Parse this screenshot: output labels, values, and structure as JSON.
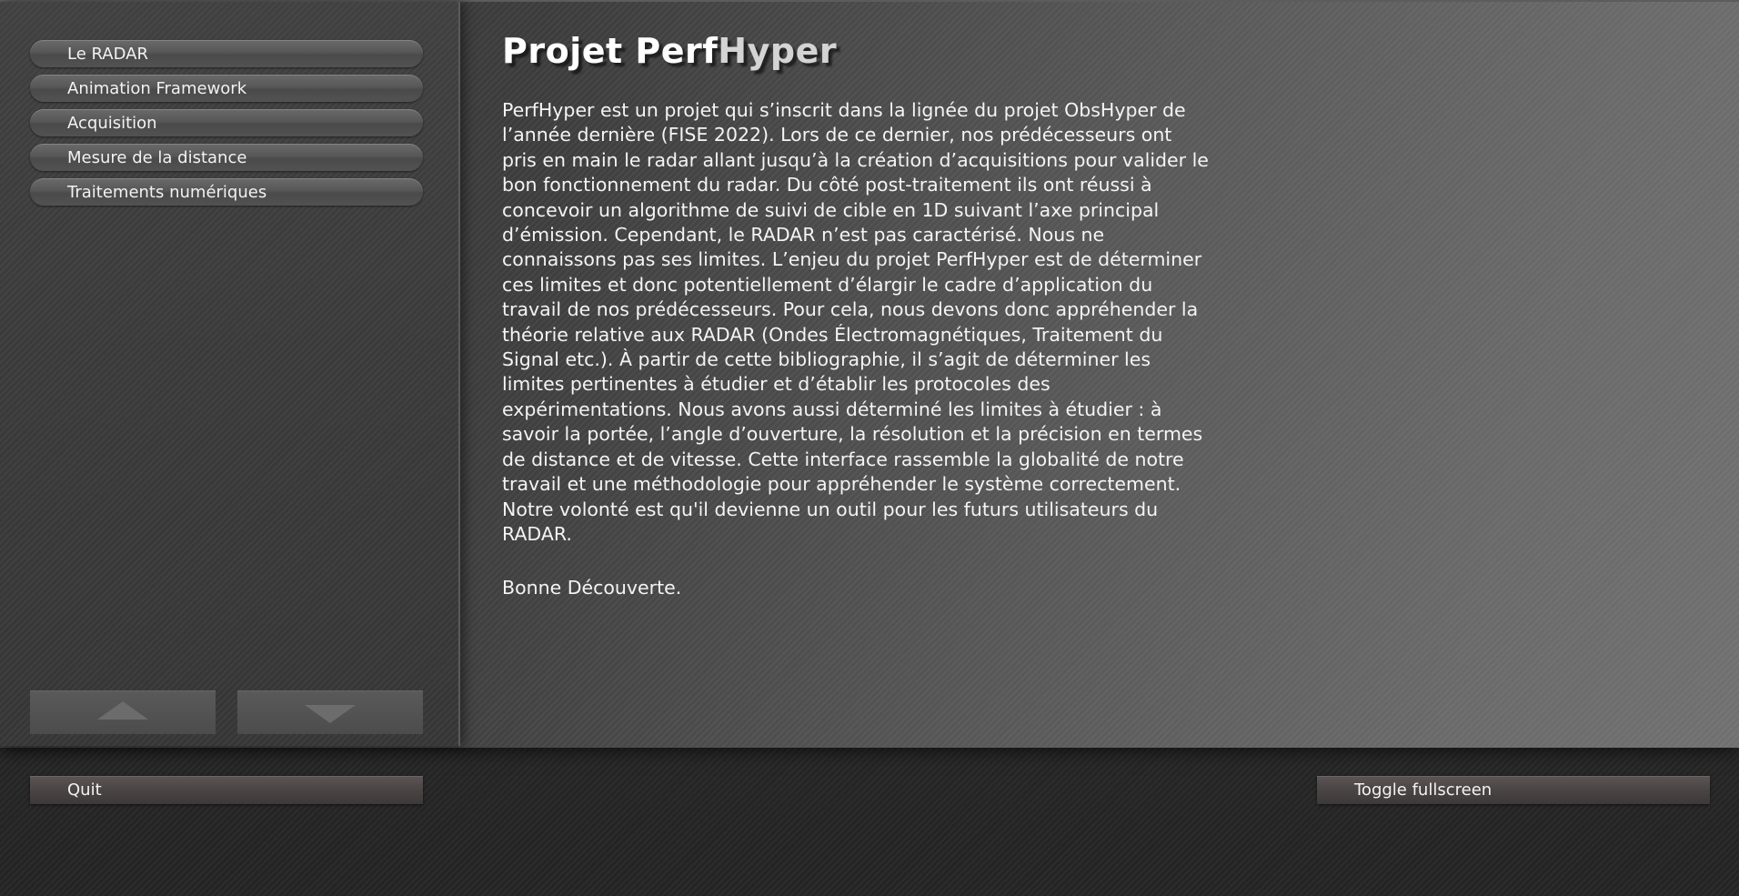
{
  "sidebar": {
    "items": [
      {
        "label": "Le RADAR"
      },
      {
        "label": "Animation Framework"
      },
      {
        "label": "Acquisition"
      },
      {
        "label": "Mesure de la distance"
      },
      {
        "label": "Traitements numériques"
      }
    ],
    "scroll_up_icon": "triangle-up",
    "scroll_down_icon": "triangle-down"
  },
  "main": {
    "title_part1": "Projet Perf",
    "title_part2": "Hyper",
    "paragraph": "PerfHyper est un projet qui s’inscrit dans la lignée du projet ObsHyper de\nl’année dernière (FISE 2022). Lors de ce dernier, nos prédécesseurs ont\npris en main le radar allant jusqu’à la création d’acquisitions pour valider le\nbon fonctionnement du radar. Du côté post-traitement ils ont réussi à\nconcevoir un algorithme de suivi de cible en 1D suivant l’axe principal\nd’émission. Cependant, le RADAR n’est pas caractérisé. Nous ne\nconnaissons pas ses limites. L’enjeu du projet PerfHyper est de déterminer\nces limites et donc potentiellement d’élargir le cadre d’application du\ntravail de nos prédécesseurs. Pour cela, nous devons donc appréhender la\nthéorie relative aux RADAR (Ondes Électromagnétiques, Traitement du\nSignal etc.). À partir de cette bibliographie, il s’agit de déterminer les\nlimites pertinentes à étudier et d’établir les protocoles des\nexpérimentations. Nous avons aussi déterminé les limites à étudier : à\nsavoir la portée, l’angle d’ouverture, la résolution et la précision en termes\nde distance et de vitesse. Cette interface rassemble la globalité de notre\ntravail et une méthodologie pour appréhender le système correctement.\nNotre volonté est qu'il devienne un outil pour les futurs utilisateurs du\nRADAR.",
    "closing": "Bonne Découverte."
  },
  "footer": {
    "quit_label": "Quit",
    "fullscreen_label": "Toggle fullscreen"
  },
  "colors": {
    "title": "#ffffff",
    "title_accent": "#d4d4d4",
    "text": "#f4f4f4",
    "button": "#575757",
    "bottom_button": "#4a4444"
  }
}
